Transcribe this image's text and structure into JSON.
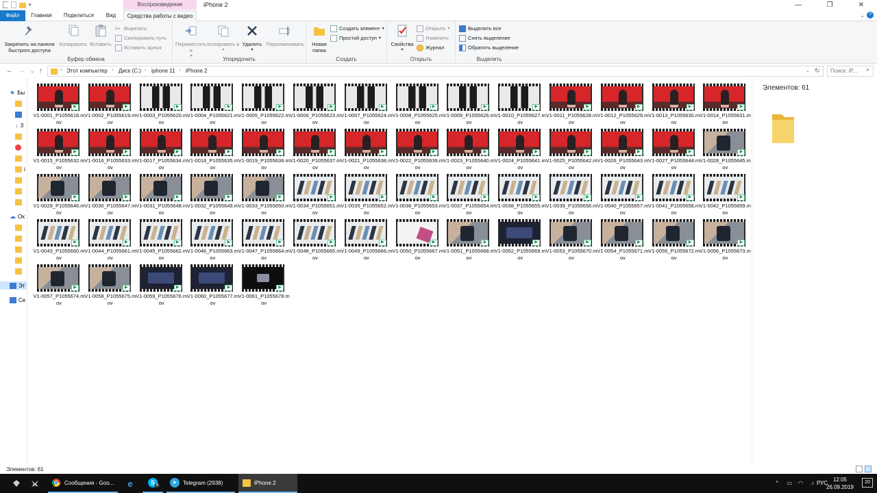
{
  "window": {
    "title": "iPhone 2",
    "context_tab_header": "Воспроизведение",
    "minimize": "—",
    "maximize": "❐",
    "close": "✕"
  },
  "tabs": [
    "Файл",
    "Главная",
    "Поделиться",
    "Вид",
    "Средства работы с видео"
  ],
  "ribbon": {
    "clipboard": {
      "label": "Буфер обмена",
      "pin": "Закрепить на панели быстрого доступа",
      "copy": "Копировать",
      "paste": "Вставить",
      "cut": "Вырезать",
      "copy_path": "Скопировать путь",
      "paste_shortcut": "Вставить ярлык"
    },
    "organize": {
      "label": "Упорядочить",
      "move_to": "Переместить в",
      "copy_to": "Копировать в",
      "delete": "Удалить",
      "rename": "Переименовать"
    },
    "create": {
      "label": "Создать",
      "new_folder": "Новая папка",
      "new_item": "Создать элемент",
      "easy_access": "Простой доступ"
    },
    "open": {
      "label": "Открыть",
      "properties": "Свойства",
      "open": "Открыть",
      "edit": "Изменить",
      "history": "Журнал"
    },
    "select": {
      "label": "Выделить",
      "select_all": "Выделить все",
      "select_none": "Снять выделение",
      "invert": "Обратить выделение"
    }
  },
  "address": {
    "crumbs": [
      "Этот компьютер",
      "Диск (C:)",
      "iphone 11",
      "iPhone 2"
    ],
    "search_placeholder": "Поиск: iP..."
  },
  "navpane": {
    "items": [
      "Бы",
      "",
      "",
      "З",
      "",
      "",
      "",
      "i",
      "",
      "",
      "",
      "Ох",
      "",
      "",
      "",
      "",
      "",
      "Эт",
      "Се"
    ]
  },
  "files": [
    {
      "name": "V1-0001_P1055618.mov",
      "thumb": "red"
    },
    {
      "name": "V1-0002_P1055619.mov",
      "thumb": "red"
    },
    {
      "name": "V1-0003_P1055620.mov",
      "thumb": "legs"
    },
    {
      "name": "V1-0004_P1055621.mov",
      "thumb": "legs"
    },
    {
      "name": "V1-0005_P1055622.mov",
      "thumb": "legs"
    },
    {
      "name": "V1-0006_P1055623.mov",
      "thumb": "legs"
    },
    {
      "name": "V1-0007_P1055624.mov",
      "thumb": "legs"
    },
    {
      "name": "V1-0008_P1055625.mov",
      "thumb": "legs"
    },
    {
      "name": "V1-0009_P1055626.mov",
      "thumb": "legs"
    },
    {
      "name": "V1-0010_P1055627.mov",
      "thumb": "legs"
    },
    {
      "name": "V1-0011_P1055628.mov",
      "thumb": "red"
    },
    {
      "name": "V1-0012_P1055629.mov",
      "thumb": "red"
    },
    {
      "name": "V1-0013_P1055630.mov",
      "thumb": "red"
    },
    {
      "name": "V1-0014_P1055631.mov",
      "thumb": "red"
    },
    {
      "name": "V1-0015_P1055632.mov",
      "thumb": "red"
    },
    {
      "name": "V1-0016_P1055633.mov",
      "thumb": "red"
    },
    {
      "name": "V1-0017_P1055634.mov",
      "thumb": "red"
    },
    {
      "name": "V1-0018_P1055635.mov",
      "thumb": "red"
    },
    {
      "name": "V1-0019_P1055636.mov",
      "thumb": "red"
    },
    {
      "name": "V1-0020_P1055637.mov",
      "thumb": "red"
    },
    {
      "name": "V1-0021_P1055638.mov",
      "thumb": "red"
    },
    {
      "name": "V1-0022_P1055639.mov",
      "thumb": "red"
    },
    {
      "name": "V1-0023_P1055640.mov",
      "thumb": "red"
    },
    {
      "name": "V1-0024_P1055641.mov",
      "thumb": "red"
    },
    {
      "name": "V1-0025_P1055642.mov",
      "thumb": "red"
    },
    {
      "name": "V1-0026_P1055643.mov",
      "thumb": "red"
    },
    {
      "name": "V1-0027_P1055644.mov",
      "thumb": "red"
    },
    {
      "name": "V1-0028_P1055645.mov",
      "thumb": "hands"
    },
    {
      "name": "V1-0029_P1055646.mov",
      "thumb": "hands"
    },
    {
      "name": "V1-0030_P1055647.mov",
      "thumb": "hands"
    },
    {
      "name": "V1-0031_P1055648.mov",
      "thumb": "hands"
    },
    {
      "name": "V1-0032_P1055649.mov",
      "thumb": "hands"
    },
    {
      "name": "V1-0033_P1055650.mov",
      "thumb": "hands"
    },
    {
      "name": "V1-0034_P1055651.mov",
      "thumb": "table"
    },
    {
      "name": "V1-0035_P1055652.mov",
      "thumb": "table"
    },
    {
      "name": "V1-0036_P1055653.mov",
      "thumb": "table"
    },
    {
      "name": "V1-0037_P1055654.mov",
      "thumb": "table"
    },
    {
      "name": "V1-0038_P1055655.mov",
      "thumb": "table"
    },
    {
      "name": "V1-0039_P1055656.mov",
      "thumb": "table"
    },
    {
      "name": "V1-0040_P1055657.mov",
      "thumb": "table"
    },
    {
      "name": "V1-0041_P1055658.mov",
      "thumb": "table"
    },
    {
      "name": "V1-0042_P1055659.mov",
      "thumb": "table"
    },
    {
      "name": "V1-0043_P1055660.mov",
      "thumb": "table"
    },
    {
      "name": "V1-0044_P1055661.mov",
      "thumb": "table"
    },
    {
      "name": "V1-0045_P1055662.mov",
      "thumb": "table"
    },
    {
      "name": "V1-0046_P1055663.mov",
      "thumb": "table"
    },
    {
      "name": "V1-0047_P1055664.mov",
      "thumb": "table"
    },
    {
      "name": "V1-0048_P1055665.mov",
      "thumb": "table"
    },
    {
      "name": "V1-0049_P1055666.mov",
      "thumb": "table"
    },
    {
      "name": "V1-0050_P1055667.mov",
      "thumb": "white"
    },
    {
      "name": "V1-0051_P1055668.mov",
      "thumb": "hands"
    },
    {
      "name": "V1-0052_P1055669.mov",
      "thumb": "dark"
    },
    {
      "name": "V1-0053_P1055670.mov",
      "thumb": "hands"
    },
    {
      "name": "V1-0054_P1055671.mov",
      "thumb": "hands"
    },
    {
      "name": "V1-0055_P1055672.mov",
      "thumb": "hands"
    },
    {
      "name": "V1-0056_P1055673.mov",
      "thumb": "hands"
    },
    {
      "name": "V1-0057_P1055674.mov",
      "thumb": "hands"
    },
    {
      "name": "V1-0058_P1055675.mov",
      "thumb": "hands"
    },
    {
      "name": "V1-0059_P1055676.mov",
      "thumb": "dark"
    },
    {
      "name": "V1-0060_P1055677.mov",
      "thumb": "dark"
    },
    {
      "name": "V1-0061_P1055678.mov",
      "thumb": "night"
    }
  ],
  "details": {
    "count": "Элементов: 61"
  },
  "status": {
    "count": "Элементов: 61"
  },
  "taskbar": {
    "chrome": "Сообщения - Goo...",
    "skype_badge": "6",
    "telegram": "Telegram (2938)",
    "explorer": "iPhone 2",
    "tray_arrow": "^",
    "lang": "РУС",
    "time": "12:05",
    "date": "26.09.2019",
    "notif_count": "20"
  },
  "colors": {
    "accent": "#1979ca",
    "context_tab": "#f7d8ee",
    "selection": "#cce8ff",
    "taskbar": "#101010"
  }
}
